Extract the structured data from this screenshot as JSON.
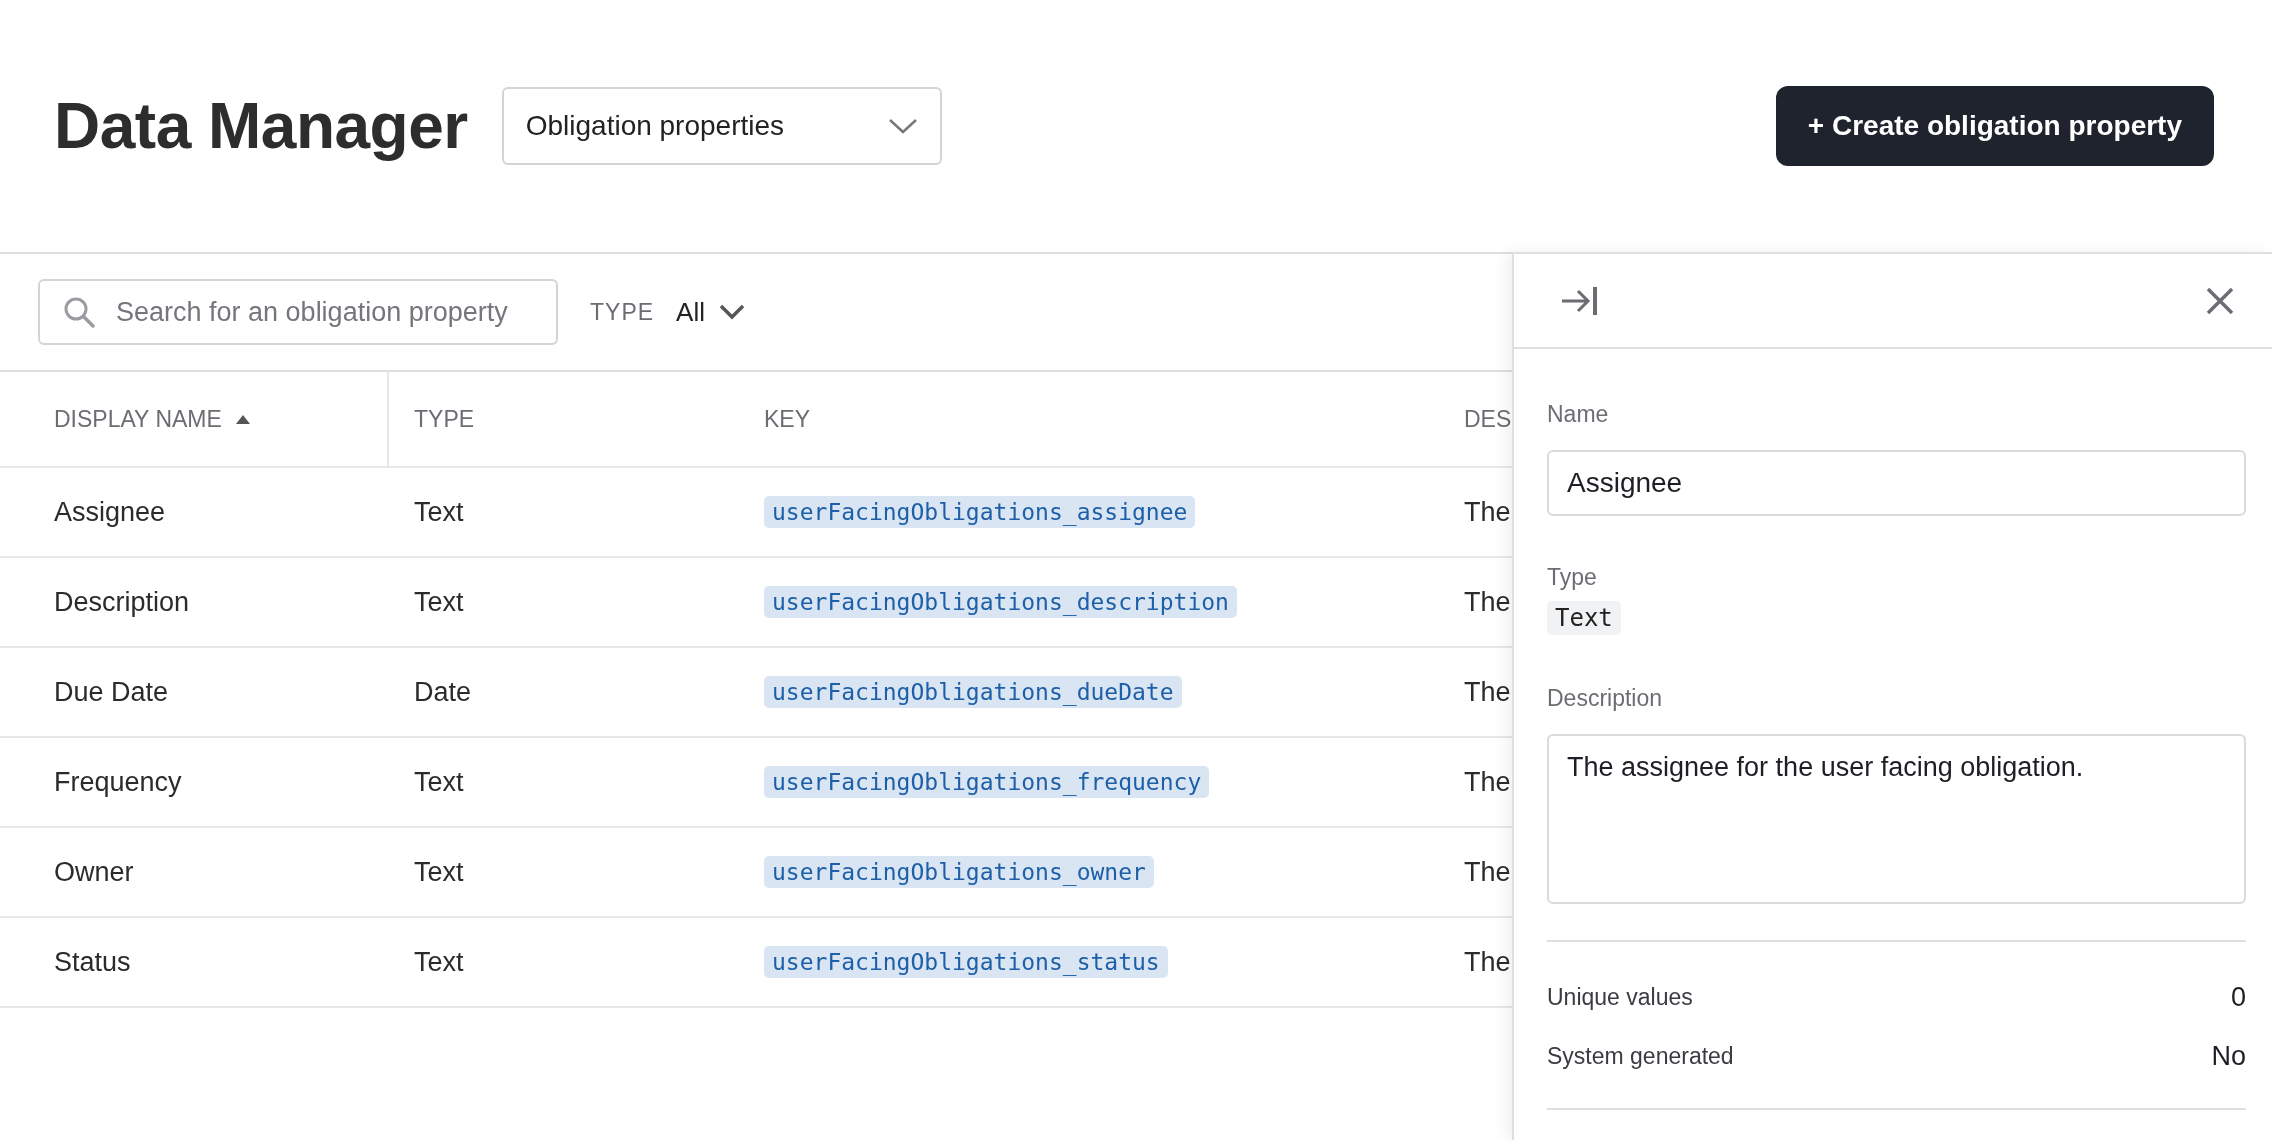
{
  "header": {
    "title": "Data Manager",
    "view_select": {
      "value": "Obligation properties"
    },
    "create_button": "+ Create obligation property"
  },
  "toolbar": {
    "search": {
      "placeholder": "Search for an obligation property"
    },
    "type_filter": {
      "label": "TYPE",
      "value": "All"
    }
  },
  "table": {
    "columns": [
      {
        "label": "DISPLAY NAME",
        "sorted": true
      },
      {
        "label": "TYPE",
        "sorted": false
      },
      {
        "label": "KEY",
        "sorted": false
      },
      {
        "label": "DES",
        "sorted": false
      }
    ],
    "rows": [
      {
        "display_name": "Assignee",
        "type": "Text",
        "key": "userFacingObligations_assignee",
        "column_4": "The"
      },
      {
        "display_name": "Description",
        "type": "Text",
        "key": "userFacingObligations_description",
        "column_4": "The"
      },
      {
        "display_name": "Due Date",
        "type": "Date",
        "key": "userFacingObligations_dueDate",
        "column_4": "The"
      },
      {
        "display_name": "Frequency",
        "type": "Text",
        "key": "userFacingObligations_frequency",
        "column_4": "The"
      },
      {
        "display_name": "Owner",
        "type": "Text",
        "key": "userFacingObligations_owner",
        "column_4": "The"
      },
      {
        "display_name": "Status",
        "type": "Text",
        "key": "userFacingObligations_status",
        "column_4": "The"
      }
    ]
  },
  "detail_panel": {
    "name": {
      "label": "Name",
      "value": "Assignee"
    },
    "type": {
      "label": "Type",
      "value": "Text"
    },
    "description": {
      "label": "Description",
      "value": "The assignee for the user facing obligation."
    },
    "stats": [
      {
        "label": "Unique values",
        "value": "0"
      },
      {
        "label": "System generated",
        "value": "No"
      }
    ]
  }
}
